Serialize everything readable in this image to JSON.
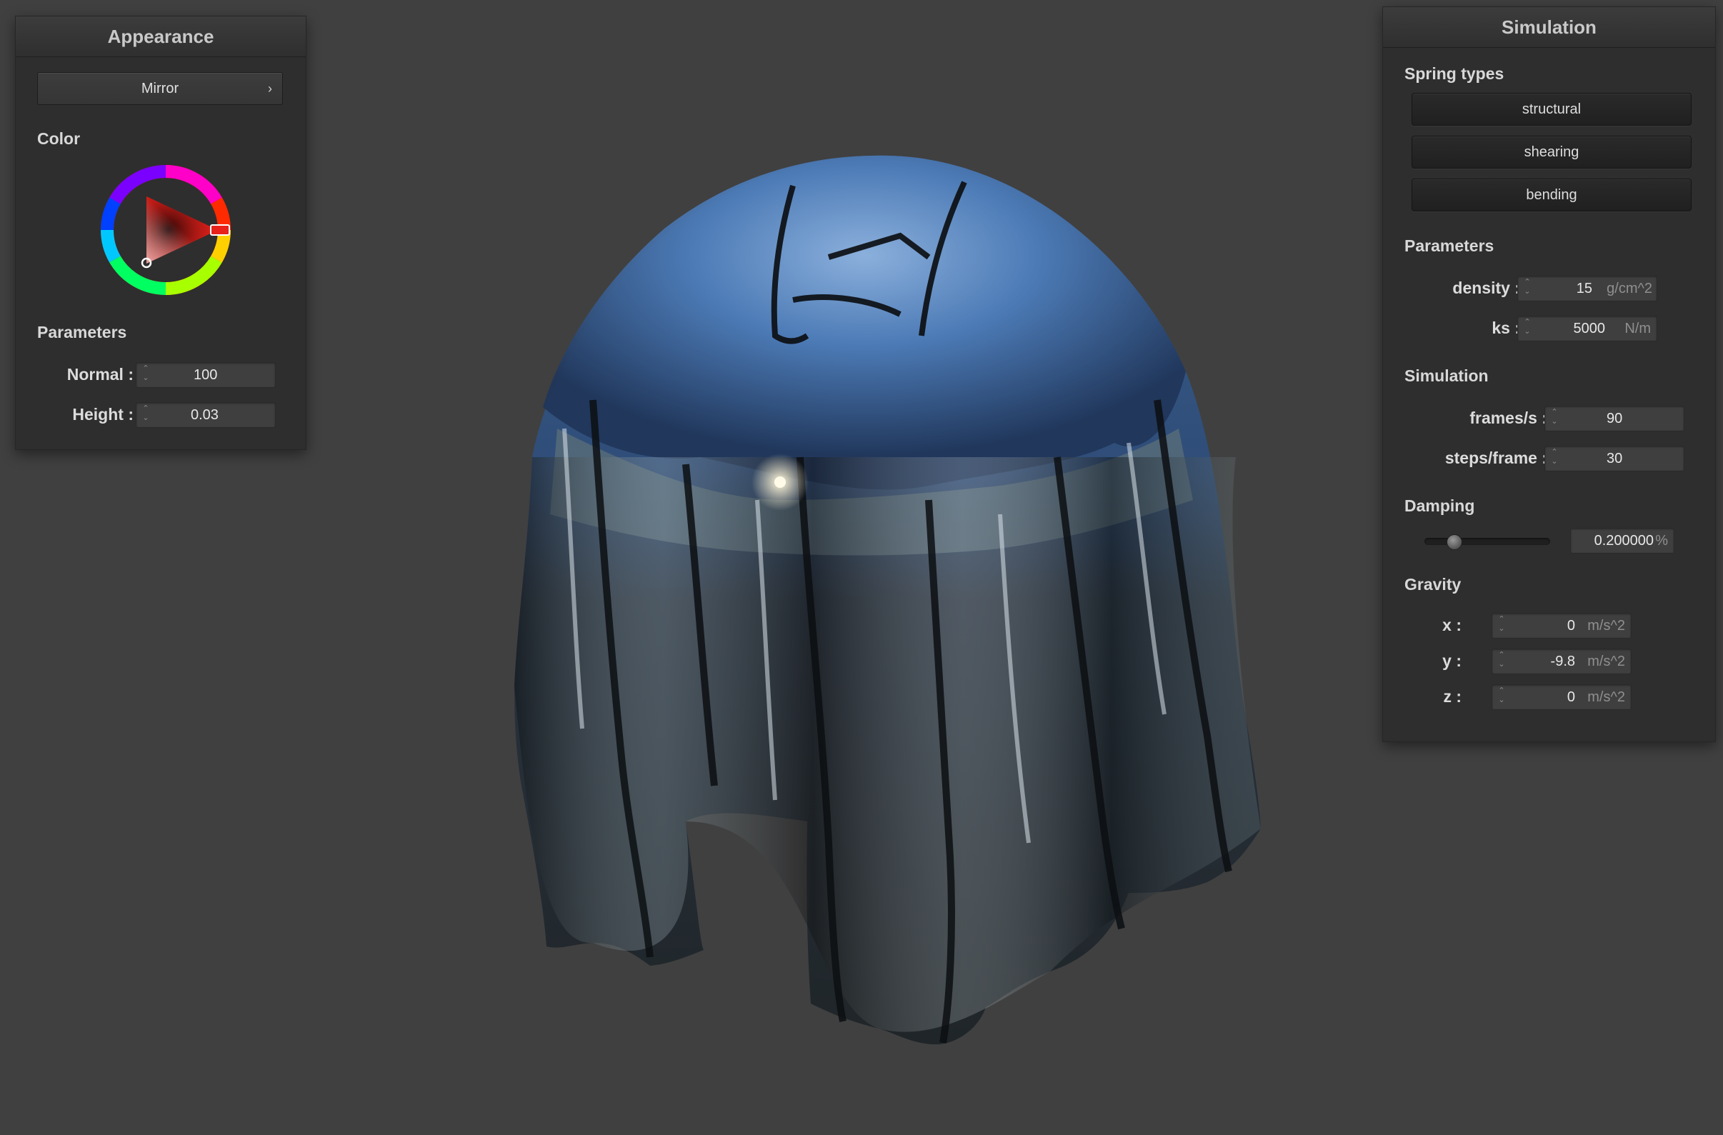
{
  "appearance": {
    "header": "Appearance",
    "material_button": "Mirror",
    "material_chevron": "›",
    "color_label": "Color",
    "color_wheel_icon": "hsv-color-wheel",
    "selected_hue_color": "#e8211b",
    "parameters_label": "Parameters",
    "normal_label": "Normal :",
    "normal_value": "100",
    "height_label": "Height :",
    "height_value": "0.03"
  },
  "simulation": {
    "header": "Simulation",
    "spring_types_label": "Spring types",
    "spring_buttons": [
      "structural",
      "shearing",
      "bending"
    ],
    "parameters_label": "Parameters",
    "density_label": "density :",
    "density_value": "15",
    "density_unit": "g/cm^2",
    "ks_label": "ks :",
    "ks_value": "5000",
    "ks_unit": "N/m",
    "simulation_label": "Simulation",
    "fps_label": "frames/s :",
    "fps_value": "90",
    "steps_label": "steps/frame :",
    "steps_value": "30",
    "damping_label": "Damping",
    "damping_value": "0.200000",
    "damping_unit": "%",
    "damping_level": 0.2,
    "gravity_label": "Gravity",
    "gx_label": "x :",
    "gx_value": "0",
    "gy_label": "y :",
    "gy_value": "-9.8",
    "gz_label": "z :",
    "gz_value": "0",
    "g_unit": "m/s^2"
  },
  "scene": {
    "object": "mirror-cloth-draped-over-sphere",
    "background_color": "#404040"
  }
}
